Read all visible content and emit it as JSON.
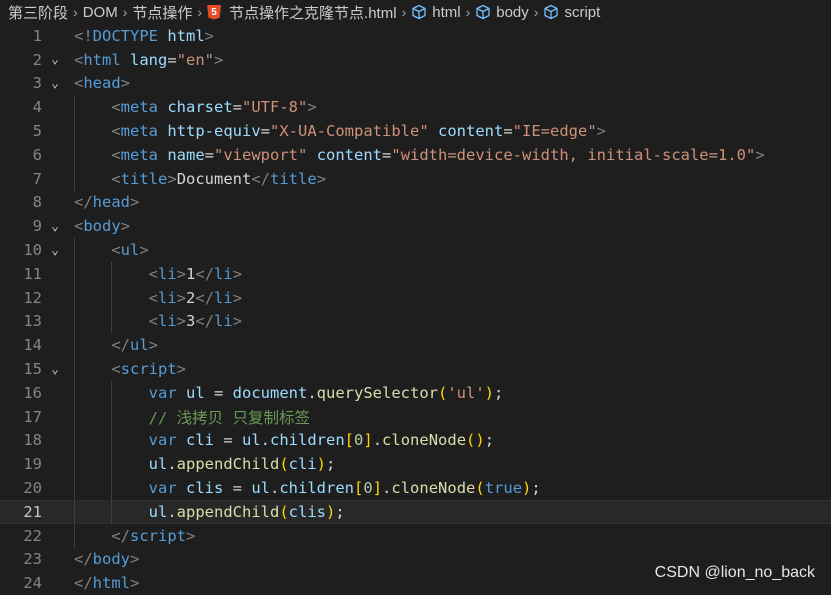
{
  "breadcrumb": {
    "items": [
      "第三阶段",
      "DOM",
      "节点操作",
      "节点操作之克隆节点.html",
      "html",
      "body",
      "script"
    ],
    "separator": "›",
    "html5_icon_label": "5"
  },
  "editor": {
    "current_line": 21,
    "lines": [
      {
        "n": "1",
        "fold": "",
        "indent": 0,
        "tokens": [
          [
            "t-tag",
            "<!"
          ],
          [
            "t-name",
            "DOCTYPE"
          ],
          [
            "t-txt",
            " "
          ],
          [
            "t-attr",
            "html"
          ],
          [
            "t-tag",
            ">"
          ]
        ]
      },
      {
        "n": "2",
        "fold": "⌄",
        "indent": 0,
        "tokens": [
          [
            "t-tag",
            "<"
          ],
          [
            "t-name",
            "html"
          ],
          [
            "t-txt",
            " "
          ],
          [
            "t-attr",
            "lang"
          ],
          [
            "t-punc",
            "="
          ],
          [
            "t-str",
            "\"en\""
          ],
          [
            "t-tag",
            ">"
          ]
        ]
      },
      {
        "n": "3",
        "fold": "⌄",
        "indent": 0,
        "tokens": [
          [
            "t-tag",
            "<"
          ],
          [
            "t-name",
            "head"
          ],
          [
            "t-tag",
            ">"
          ]
        ]
      },
      {
        "n": "4",
        "fold": "",
        "indent": 1,
        "tokens": [
          [
            "t-tag",
            "<"
          ],
          [
            "t-name",
            "meta"
          ],
          [
            "t-txt",
            " "
          ],
          [
            "t-attr",
            "charset"
          ],
          [
            "t-punc",
            "="
          ],
          [
            "t-str",
            "\"UTF-8\""
          ],
          [
            "t-tag",
            ">"
          ]
        ]
      },
      {
        "n": "5",
        "fold": "",
        "indent": 1,
        "tokens": [
          [
            "t-tag",
            "<"
          ],
          [
            "t-name",
            "meta"
          ],
          [
            "t-txt",
            " "
          ],
          [
            "t-attr",
            "http-equiv"
          ],
          [
            "t-punc",
            "="
          ],
          [
            "t-str",
            "\"X-UA-Compatible\""
          ],
          [
            "t-txt",
            " "
          ],
          [
            "t-attr",
            "content"
          ],
          [
            "t-punc",
            "="
          ],
          [
            "t-str",
            "\"IE=edge\""
          ],
          [
            "t-tag",
            ">"
          ]
        ]
      },
      {
        "n": "6",
        "fold": "",
        "indent": 1,
        "tokens": [
          [
            "t-tag",
            "<"
          ],
          [
            "t-name",
            "meta"
          ],
          [
            "t-txt",
            " "
          ],
          [
            "t-attr",
            "name"
          ],
          [
            "t-punc",
            "="
          ],
          [
            "t-str",
            "\"viewport\""
          ],
          [
            "t-txt",
            " "
          ],
          [
            "t-attr",
            "content"
          ],
          [
            "t-punc",
            "="
          ],
          [
            "t-str",
            "\"width=device-width, initial-scale=1.0\""
          ],
          [
            "t-tag",
            ">"
          ]
        ]
      },
      {
        "n": "7",
        "fold": "",
        "indent": 1,
        "tokens": [
          [
            "t-tag",
            "<"
          ],
          [
            "t-name",
            "title"
          ],
          [
            "t-tag",
            ">"
          ],
          [
            "t-txt",
            "Document"
          ],
          [
            "t-tag",
            "</"
          ],
          [
            "t-name",
            "title"
          ],
          [
            "t-tag",
            ">"
          ]
        ]
      },
      {
        "n": "8",
        "fold": "",
        "indent": 0,
        "tokens": [
          [
            "t-tag",
            "</"
          ],
          [
            "t-name",
            "head"
          ],
          [
            "t-tag",
            ">"
          ]
        ]
      },
      {
        "n": "9",
        "fold": "⌄",
        "indent": 0,
        "tokens": [
          [
            "t-tag",
            "<"
          ],
          [
            "t-name",
            "body"
          ],
          [
            "t-tag",
            ">"
          ]
        ]
      },
      {
        "n": "10",
        "fold": "⌄",
        "indent": 1,
        "tokens": [
          [
            "t-tag",
            "<"
          ],
          [
            "t-name",
            "ul"
          ],
          [
            "t-tag",
            ">"
          ]
        ]
      },
      {
        "n": "11",
        "fold": "",
        "indent": 2,
        "tokens": [
          [
            "t-tag",
            "<"
          ],
          [
            "t-name",
            "li"
          ],
          [
            "t-tag",
            ">"
          ],
          [
            "t-txt",
            "1"
          ],
          [
            "t-tag",
            "</"
          ],
          [
            "t-name",
            "li"
          ],
          [
            "t-tag",
            ">"
          ]
        ]
      },
      {
        "n": "12",
        "fold": "",
        "indent": 2,
        "tokens": [
          [
            "t-tag",
            "<"
          ],
          [
            "t-name",
            "li"
          ],
          [
            "t-tag",
            ">"
          ],
          [
            "t-txt",
            "2"
          ],
          [
            "t-tag",
            "</"
          ],
          [
            "t-name",
            "li"
          ],
          [
            "t-tag",
            ">"
          ]
        ]
      },
      {
        "n": "13",
        "fold": "",
        "indent": 2,
        "tokens": [
          [
            "t-tag",
            "<"
          ],
          [
            "t-name",
            "li"
          ],
          [
            "t-tag",
            ">"
          ],
          [
            "t-txt",
            "3"
          ],
          [
            "t-tag",
            "</"
          ],
          [
            "t-name",
            "li"
          ],
          [
            "t-tag",
            ">"
          ]
        ]
      },
      {
        "n": "14",
        "fold": "",
        "indent": 1,
        "tokens": [
          [
            "t-tag",
            "</"
          ],
          [
            "t-name",
            "ul"
          ],
          [
            "t-tag",
            ">"
          ]
        ]
      },
      {
        "n": "15",
        "fold": "⌄",
        "indent": 1,
        "tokens": [
          [
            "t-tag",
            "<"
          ],
          [
            "t-name",
            "script"
          ],
          [
            "t-tag",
            ">"
          ]
        ]
      },
      {
        "n": "16",
        "fold": "",
        "indent": 2,
        "tokens": [
          [
            "t-kw",
            "var"
          ],
          [
            "t-txt",
            " "
          ],
          [
            "t-var",
            "ul"
          ],
          [
            "t-txt",
            " = "
          ],
          [
            "t-var",
            "document"
          ],
          [
            "t-punc",
            "."
          ],
          [
            "t-fn",
            "querySelector"
          ],
          [
            "t-p1",
            "("
          ],
          [
            "t-str",
            "'ul'"
          ],
          [
            "t-p1",
            ")"
          ],
          [
            "t-punc",
            ";"
          ]
        ]
      },
      {
        "n": "17",
        "fold": "",
        "indent": 2,
        "tokens": [
          [
            "t-cmt",
            "// 浅拷贝 只复制标签"
          ]
        ]
      },
      {
        "n": "18",
        "fold": "",
        "indent": 2,
        "tokens": [
          [
            "t-kw",
            "var"
          ],
          [
            "t-txt",
            " "
          ],
          [
            "t-var",
            "cli"
          ],
          [
            "t-txt",
            " = "
          ],
          [
            "t-var",
            "ul"
          ],
          [
            "t-punc",
            "."
          ],
          [
            "t-var",
            "children"
          ],
          [
            "t-p1",
            "["
          ],
          [
            "t-num",
            "0"
          ],
          [
            "t-p1",
            "]"
          ],
          [
            "t-punc",
            "."
          ],
          [
            "t-fn",
            "cloneNode"
          ],
          [
            "t-p1",
            "()"
          ],
          [
            "t-punc",
            ";"
          ]
        ]
      },
      {
        "n": "19",
        "fold": "",
        "indent": 2,
        "tokens": [
          [
            "t-var",
            "ul"
          ],
          [
            "t-punc",
            "."
          ],
          [
            "t-fn",
            "appendChild"
          ],
          [
            "t-p1",
            "("
          ],
          [
            "t-var",
            "cli"
          ],
          [
            "t-p1",
            ")"
          ],
          [
            "t-punc",
            ";"
          ]
        ]
      },
      {
        "n": "20",
        "fold": "",
        "indent": 2,
        "tokens": [
          [
            "t-kw",
            "var"
          ],
          [
            "t-txt",
            " "
          ],
          [
            "t-var",
            "clis"
          ],
          [
            "t-txt",
            " = "
          ],
          [
            "t-var",
            "ul"
          ],
          [
            "t-punc",
            "."
          ],
          [
            "t-var",
            "children"
          ],
          [
            "t-p1",
            "["
          ],
          [
            "t-num",
            "0"
          ],
          [
            "t-p1",
            "]"
          ],
          [
            "t-punc",
            "."
          ],
          [
            "t-fn",
            "cloneNode"
          ],
          [
            "t-p1",
            "("
          ],
          [
            "t-kw",
            "true"
          ],
          [
            "t-p1",
            ")"
          ],
          [
            "t-punc",
            ";"
          ]
        ]
      },
      {
        "n": "21",
        "fold": "",
        "indent": 2,
        "tokens": [
          [
            "t-var",
            "ul"
          ],
          [
            "t-punc",
            "."
          ],
          [
            "t-fn",
            "appendChild"
          ],
          [
            "t-p1",
            "("
          ],
          [
            "t-var",
            "clis"
          ],
          [
            "t-p1",
            ")"
          ],
          [
            "t-punc",
            ";"
          ]
        ]
      },
      {
        "n": "22",
        "fold": "",
        "indent": 1,
        "tokens": [
          [
            "t-tag",
            "</"
          ],
          [
            "t-name",
            "script"
          ],
          [
            "t-tag",
            ">"
          ]
        ]
      },
      {
        "n": "23",
        "fold": "",
        "indent": 0,
        "tokens": [
          [
            "t-tag",
            "</"
          ],
          [
            "t-name",
            "body"
          ],
          [
            "t-tag",
            ">"
          ]
        ]
      },
      {
        "n": "24",
        "fold": "",
        "indent": 0,
        "tokens": [
          [
            "t-tag",
            "</"
          ],
          [
            "t-name",
            "html"
          ],
          [
            "t-tag",
            ">"
          ]
        ]
      }
    ]
  },
  "watermark": "CSDN @lion_no_back"
}
